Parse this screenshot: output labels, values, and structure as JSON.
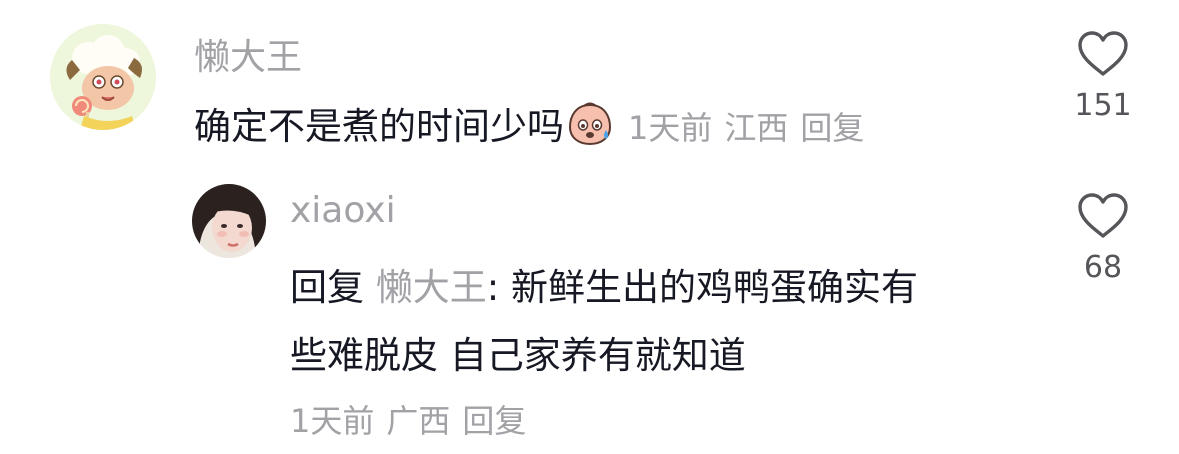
{
  "comments": [
    {
      "username": "懒大王",
      "text": "确定不是煮的时间少吗",
      "emoji": "sweat-face-emoji",
      "time": "1天前",
      "location": "江西",
      "reply_label": "回复",
      "like_count": "151",
      "icons": {
        "like": "heart-outline-icon"
      }
    },
    {
      "username": "xiaoxi",
      "reply_prefix": "回复",
      "reply_to": "懒大王",
      "text_line1": ": 新鲜生出的鸡鸭蛋确实有",
      "text_line2": "些难脱皮 自己家养有就知道",
      "time": "1天前",
      "location": "广西",
      "reply_label": "回复",
      "like_count": "68",
      "icons": {
        "like": "heart-outline-icon"
      }
    }
  ],
  "colors": {
    "text": "#161823",
    "secondary": "#a1a1a6",
    "like_icon": "#55555a"
  }
}
